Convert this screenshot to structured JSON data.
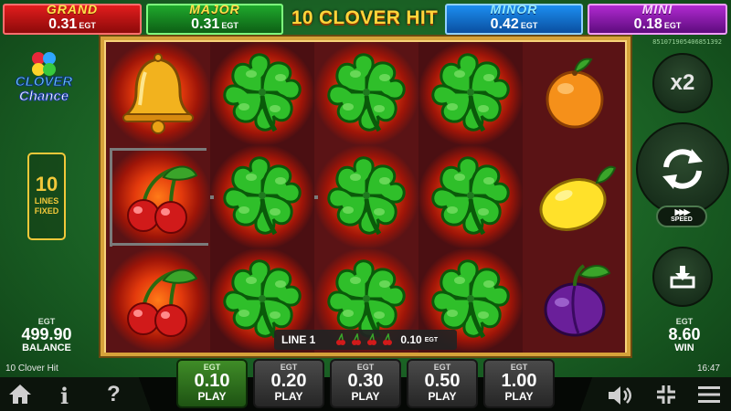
{
  "jackpots": [
    {
      "name": "GRAND",
      "value": "0.31",
      "currency": "EGT"
    },
    {
      "name": "MAJOR",
      "value": "0.31",
      "currency": "EGT"
    },
    {
      "name": "MINOR",
      "value": "0.42",
      "currency": "EGT"
    },
    {
      "name": "MINI",
      "value": "0.18",
      "currency": "EGT"
    }
  ],
  "header": {
    "game_title": "10 CLOVER HIT",
    "serial": "851071905406851392"
  },
  "logo": {
    "line1": "CLOVER",
    "line2": "Chance"
  },
  "lines": {
    "count": "10",
    "label1": "LINES",
    "label2": "FIXED"
  },
  "reels": [
    [
      "bell",
      "cherry",
      "cherry"
    ],
    [
      "clover",
      "clover",
      "clover"
    ],
    [
      "clover",
      "clover",
      "clover"
    ],
    [
      "clover",
      "clover",
      "clover"
    ],
    [
      "orange",
      "lemon",
      "plum"
    ]
  ],
  "line_win": {
    "label": "LINE 1",
    "symbols": [
      "cherry",
      "cherry",
      "cherry",
      "cherry"
    ],
    "amount": "0.10",
    "currency": "EGT"
  },
  "balance": {
    "currency": "EGT",
    "value": "499.90",
    "label": "BALANCE"
  },
  "win": {
    "currency": "EGT",
    "value": "8.60",
    "label": "WIN"
  },
  "controls": {
    "multiplier_label": "x2",
    "speed_label": "SPEED",
    "speed_icon": "fast-forward-icon",
    "spin_icon": "refresh-icon",
    "collect_icon": "download-icon"
  },
  "bets": [
    {
      "currency": "EGT",
      "amount": "0.10",
      "label": "PLAY",
      "active": true
    },
    {
      "currency": "EGT",
      "amount": "0.20",
      "label": "PLAY",
      "active": false
    },
    {
      "currency": "EGT",
      "amount": "0.30",
      "label": "PLAY",
      "active": false
    },
    {
      "currency": "EGT",
      "amount": "0.50",
      "label": "PLAY",
      "active": false
    },
    {
      "currency": "EGT",
      "amount": "1.00",
      "label": "PLAY",
      "active": false
    }
  ],
  "footer": {
    "game_name": "10 Clover Hit",
    "time": "16:47",
    "help_glyph": "?",
    "info_glyph": "i"
  },
  "colors": {
    "accent_gold": "#f2c83a",
    "active_bet": "#3f8c27",
    "background_green": "#1d6a28",
    "reel_background": "#4a0d10"
  }
}
